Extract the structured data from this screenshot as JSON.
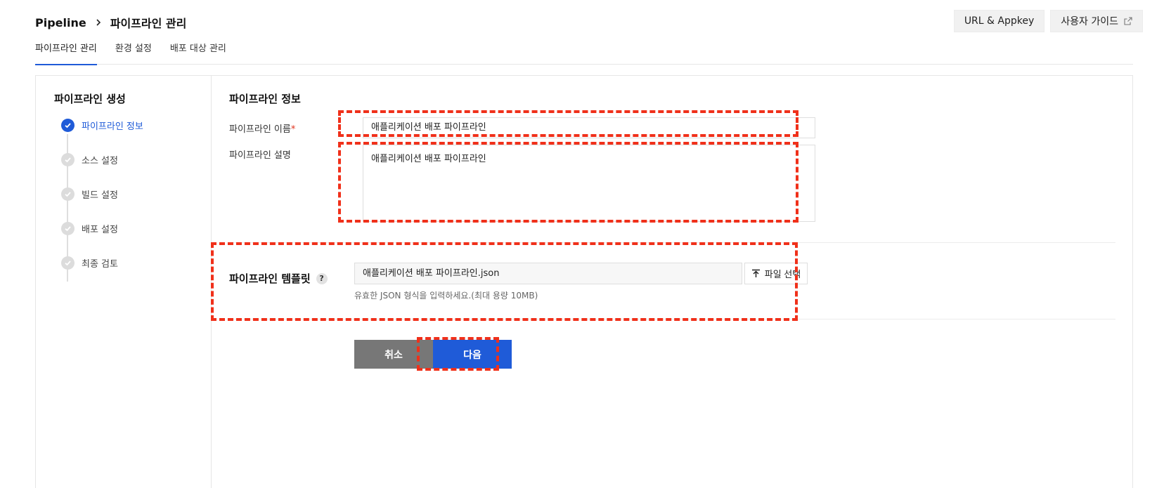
{
  "breadcrumb": {
    "root": "Pipeline",
    "current": "파이프라인 관리"
  },
  "top_actions": {
    "url_appkey": "URL & Appkey",
    "user_guide": "사용자 가이드"
  },
  "tabs": [
    {
      "label": "파이프라인 관리",
      "active": true
    },
    {
      "label": "환경 설정",
      "active": false
    },
    {
      "label": "배포 대상 관리",
      "active": false
    }
  ],
  "steps": {
    "title": "파이프라인 생성",
    "items": [
      {
        "label": "파이프라인 정보",
        "state": "done"
      },
      {
        "label": "소스 설정",
        "state": "pending"
      },
      {
        "label": "빌드 설정",
        "state": "pending"
      },
      {
        "label": "배포 설정",
        "state": "pending"
      },
      {
        "label": "최종 검토",
        "state": "pending"
      }
    ]
  },
  "form": {
    "section_title": "파이프라인 정보",
    "name_label": "파이프라인 이름",
    "required_mark": "*",
    "name_value": "애플리케이션 배포 파이프라인",
    "desc_label": "파이프라인 설명",
    "desc_value": "애플리케이션 배포 파이프라인",
    "template_label": "파이프라인 템플릿",
    "help_glyph": "?",
    "template_file": "애플리케이션 배포 파이프라인.json",
    "file_select_label": "파일 선택",
    "hint": "유효한 JSON 형식을 입력하세요.(최대 용량 10MB)"
  },
  "buttons": {
    "cancel": "취소",
    "next": "다음"
  },
  "colors": {
    "accent": "#1f5bd8",
    "highlight": "#f0301a",
    "cancel": "#777777"
  }
}
